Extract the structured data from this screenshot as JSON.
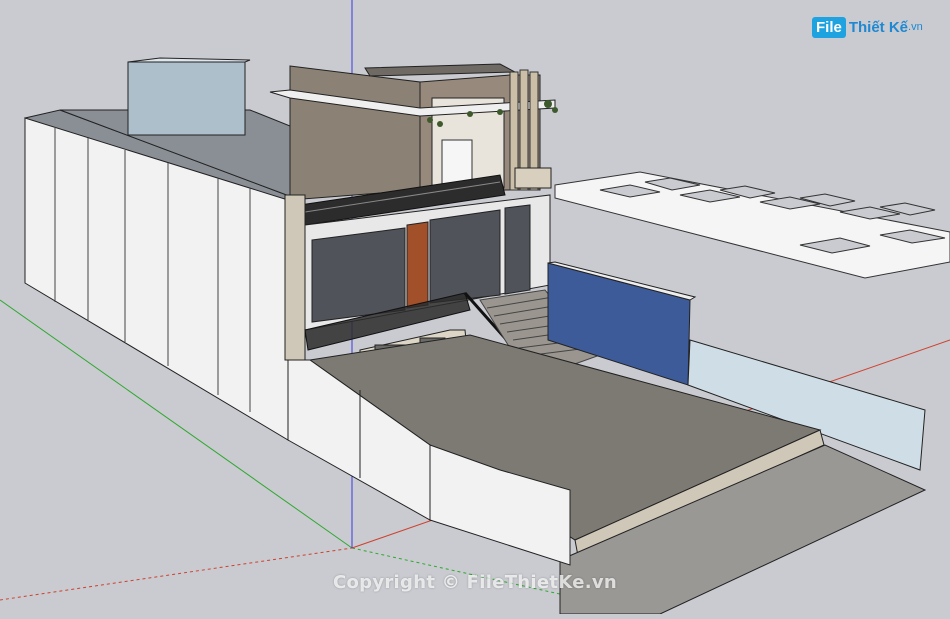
{
  "watermark": {
    "logo_box": "File",
    "logo_text": "Thiết Kế",
    "logo_ext": ".vn",
    "copyright": "Copyright © FileThietKe.vn"
  },
  "colors": {
    "background": "#c9cbd0",
    "axis_red": "#d0402e",
    "axis_green": "#2fa82f",
    "axis_blue": "#3a3ae0",
    "wall_white": "#f2f2f2",
    "roof_gray": "#8a8f96",
    "glass_blue": "#aebfcc",
    "floor_gray": "#7d7a74",
    "blue_wall": "#3d5a99",
    "wood": "#a2502a",
    "stone": "#cfc8b8"
  },
  "icons": [
    "logo-icon"
  ]
}
